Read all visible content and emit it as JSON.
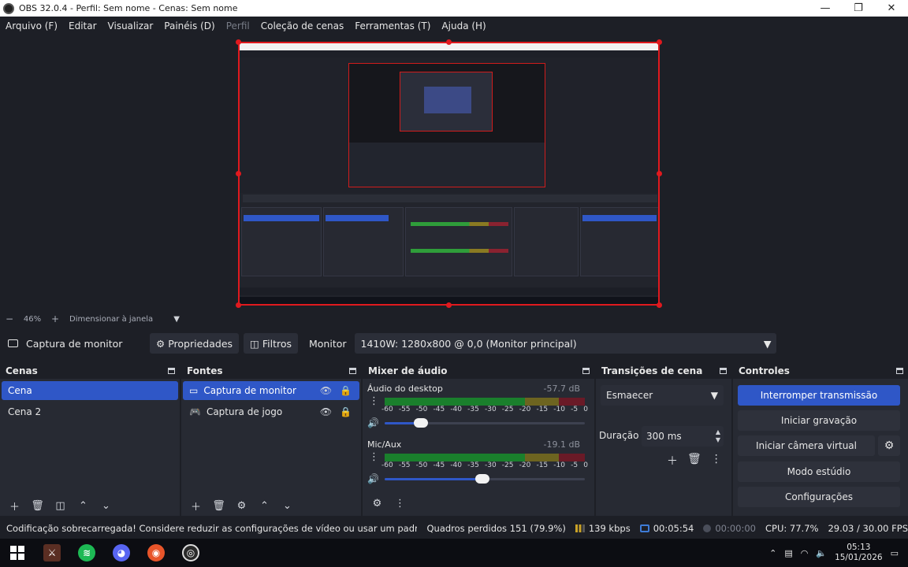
{
  "window": {
    "title": "OBS 32.0.4 - Perfil: Sem nome - Cenas: Sem nome",
    "min": "—",
    "max": "❐",
    "close": "✕"
  },
  "menu": [
    "Arquivo (F)",
    "Editar",
    "Visualizar",
    "Painéis (D)",
    "Perfil",
    "Coleção de cenas",
    "Ferramentas (T)",
    "Ajuda (H)"
  ],
  "zoom": {
    "minus": "−",
    "value": "46%",
    "plus": "+",
    "scale_label": "Dimensionar à janela",
    "caret": "▼"
  },
  "source_toolbar": {
    "source_name": "Captura de monitor",
    "properties": "Propriedades",
    "filters": "Filtros",
    "monitor_label": "Monitor",
    "monitor_value": "1410W: 1280x800 @ 0,0 (Monitor principal)"
  },
  "scenes": {
    "title": "Cenas",
    "items": [
      "Cena",
      "Cena 2"
    ],
    "selected_index": 0
  },
  "sources": {
    "title": "Fontes",
    "items": [
      {
        "name": "Captura de monitor",
        "icon": "monitor-icon"
      },
      {
        "name": "Captura de jogo",
        "icon": "gamepad-icon"
      }
    ],
    "selected_index": 0
  },
  "mixer": {
    "title": "Mixer de áudio",
    "ticks": [
      "-60",
      "-55",
      "-50",
      "-45",
      "-40",
      "-35",
      "-30",
      "-25",
      "-20",
      "-15",
      "-10",
      "-5",
      "0"
    ],
    "channels": [
      {
        "name": "Áudio do desktop",
        "db": "-57.7 dB",
        "volume": 0.18
      },
      {
        "name": "Mic/Aux",
        "db": "-19.1 dB",
        "volume": 0.49
      }
    ]
  },
  "transitions": {
    "title": "Transições de cena",
    "selected": "Esmaecer",
    "duration_label": "Duração",
    "duration_value": "300 ms"
  },
  "controls": {
    "title": "Controles",
    "stop_stream": "Interromper transmissão",
    "start_recording": "Iniciar gravação",
    "start_virtual_camera": "Iniciar câmera virtual",
    "studio_mode": "Modo estúdio",
    "settings": "Configurações"
  },
  "status": {
    "warning": "Codificação sobrecarregada! Considere reduzir as configurações de vídeo ou usar um padrão de codifi",
    "dropped_frames": "Quadros perdidos 151 (79.9%)",
    "bitrate": "139 kbps",
    "stream_time": "00:05:54",
    "record_time": "00:00:00",
    "cpu": "CPU: 77.7%",
    "fps": "29.03 / 30.00 FPS"
  },
  "taskbar": {
    "time": "05:13",
    "date": "15/01/2026",
    "chevron": "⌃"
  },
  "colors": {
    "accent": "#2f57c7",
    "selection_border": "#e0191e",
    "meter_green": "#1a7f2c",
    "meter_yellow": "#6d6420",
    "meter_red": "#6a1a27"
  }
}
